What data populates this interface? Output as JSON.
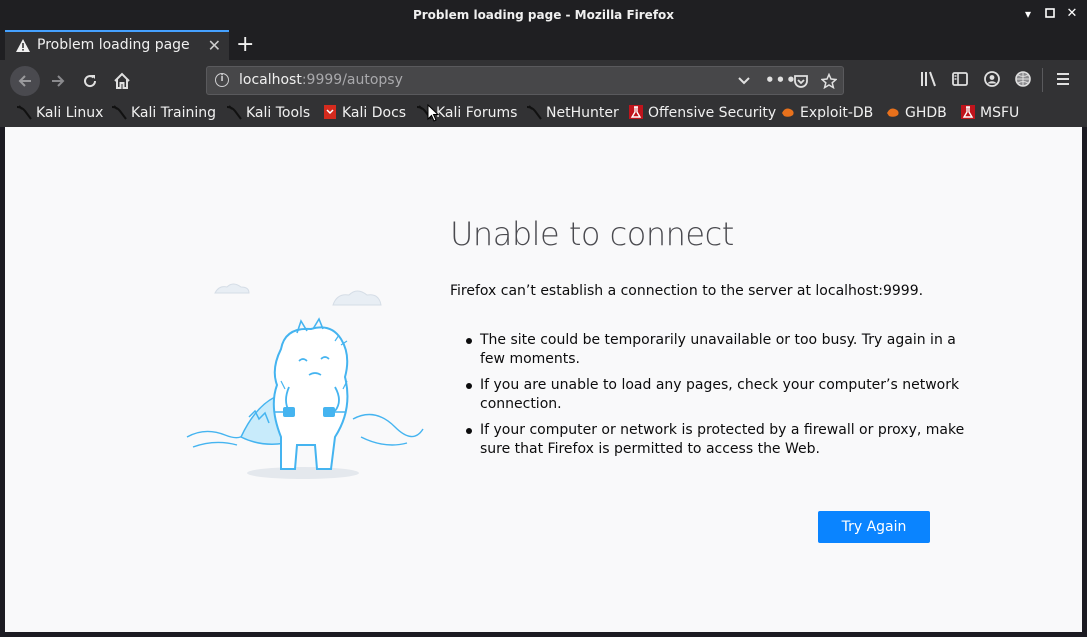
{
  "window": {
    "title": "Problem loading page - Mozilla Firefox"
  },
  "tab": {
    "title": "Problem loading page"
  },
  "url": {
    "host": "localhost",
    "rest": ":9999/autopsy"
  },
  "bookmarks": [
    {
      "label": "Kali Linux",
      "icon": "kali-dragon-icon"
    },
    {
      "label": "Kali Training",
      "icon": "kali-dragon-icon"
    },
    {
      "label": "Kali Tools",
      "icon": "kali-dragon-icon"
    },
    {
      "label": "Kali Docs",
      "icon": "kali-docs-icon"
    },
    {
      "label": "Kali Forums",
      "icon": "kali-dragon-icon"
    },
    {
      "label": "NetHunter",
      "icon": "kali-dragon-icon"
    },
    {
      "label": "Offensive Security",
      "icon": "offsec-icon"
    },
    {
      "label": "Exploit-DB",
      "icon": "exploitdb-icon"
    },
    {
      "label": "GHDB",
      "icon": "exploitdb-icon"
    },
    {
      "label": "MSFU",
      "icon": "offsec-icon"
    }
  ],
  "error": {
    "heading": "Unable to connect",
    "message": "Firefox can’t establish a connection to the server at localhost:9999.",
    "reasons": [
      "The site could be temporarily unavailable or too busy. Try again in a few moments.",
      "If you are unable to load any pages, check your computer’s network connection.",
      "If your computer or network is protected by a firewall or proxy, make sure that Firefox is permitted to access the Web."
    ],
    "button": "Try Again"
  },
  "colors": {
    "accent": "#0a84ff",
    "tab_highlight": "#45a1ff",
    "toolbar": "#323234",
    "titlebar": "#1f1f22"
  }
}
